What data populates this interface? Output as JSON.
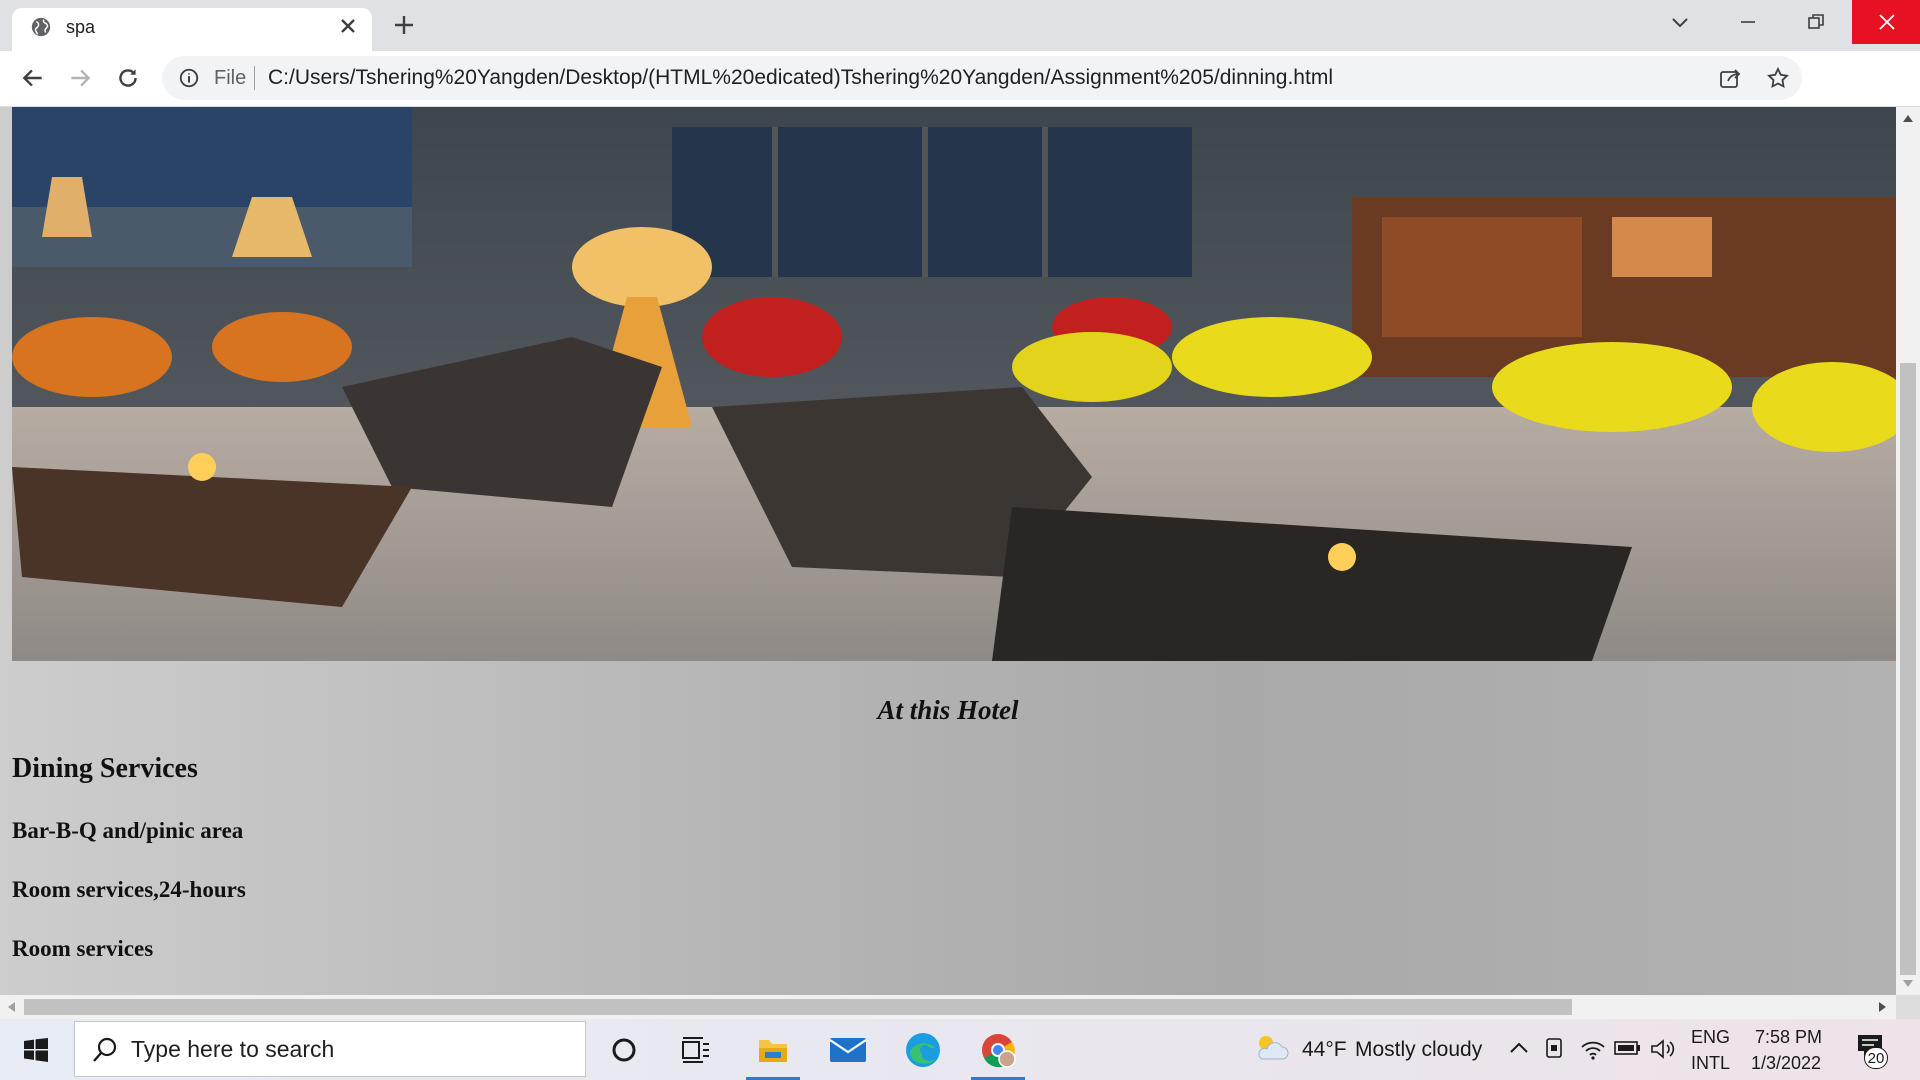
{
  "browser": {
    "tab_title": "spa",
    "omnibox_prefix": "File",
    "url": "C:/Users/Tshering%20Yangden/Desktop/(HTML%20edicated)Tshering%20Yangden/Assignment%205/dinning.html"
  },
  "page": {
    "caption": "At this Hotel",
    "heading": "Dining Services",
    "items": [
      "Bar-B-Q and/pinic area",
      "Room services,24-hours",
      "Room services"
    ]
  },
  "taskbar": {
    "search_placeholder": "Type here to search",
    "weather_temp": "44°F",
    "weather_desc": "Mostly cloudy",
    "lang_top": "ENG",
    "lang_bottom": "INTL",
    "time": "7:58 PM",
    "date": "1/3/2022",
    "notification_count": "20"
  },
  "colors": {
    "accent": "#2b7bd8",
    "close_red": "#e81123"
  }
}
